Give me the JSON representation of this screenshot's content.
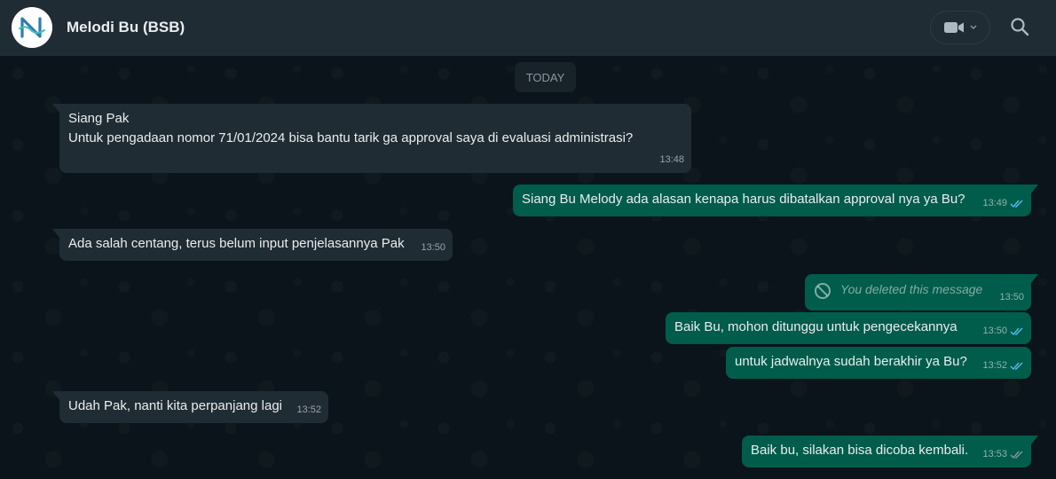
{
  "header": {
    "contact_name": "Melodi Bu (BSB)",
    "avatar_letter": "N",
    "video_icon": "video-camera-icon",
    "search_icon": "search-icon"
  },
  "chat": {
    "date_chip": "TODAY",
    "messages": [
      {
        "direction": "in",
        "lines": [
          "Siang Pak",
          "Untuk pengadaan nomor 71/01/2024 bisa bantu tarik ga approval saya di evaluasi administrasi?"
        ],
        "time": "13:48"
      },
      {
        "direction": "out",
        "text": "Siang Bu Melody ada alasan kenapa harus dibatalkan approval nya ya Bu?",
        "time": "13:49",
        "status": "read"
      },
      {
        "direction": "in",
        "text": "Ada salah centang, terus belum input penjelasannya Pak",
        "time": "13:50"
      },
      {
        "direction": "out",
        "text": "You deleted this message",
        "time": "13:50",
        "deleted": true
      },
      {
        "direction": "out",
        "text": "Baik Bu, mohon  ditunggu untuk pengecekannya",
        "time": "13:50",
        "status": "read"
      },
      {
        "direction": "out",
        "text": "untuk jadwalnya sudah berakhir ya Bu?",
        "time": "13:52",
        "status": "read"
      },
      {
        "direction": "in",
        "text": "Udah Pak, nanti kita perpanjang lagi",
        "time": "13:52"
      },
      {
        "direction": "out",
        "text": "Baik bu, silakan bisa dicoba kembali.",
        "time": "13:53",
        "status": "sent"
      }
    ]
  },
  "colors": {
    "header_bg": "#202c33",
    "chat_bg": "#0b141a",
    "incoming_bubble": "#202c33",
    "outgoing_bubble": "#005c4b",
    "read_tick": "#53bdeb",
    "sent_tick": "#8696a0"
  }
}
